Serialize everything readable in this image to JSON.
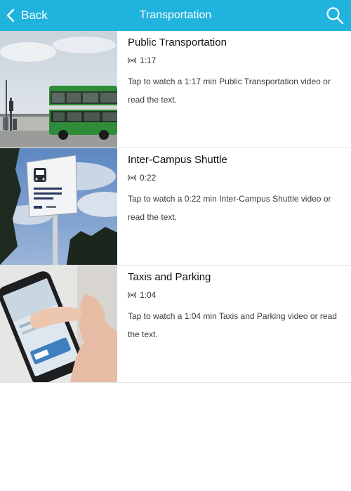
{
  "navbar": {
    "back_label": "Back",
    "title": "Transportation",
    "search_icon": "search-icon",
    "back_icon": "chevron-left-icon",
    "background_color": "#20b3dd"
  },
  "items": [
    {
      "title": "Public Transportation",
      "duration": "1:17",
      "description": "Tap to watch a 1:17 min Public Transportation video or read the text.",
      "thumbnail": "bus-photo"
    },
    {
      "title": "Inter-Campus Shuttle",
      "duration": "0:22",
      "description": "Tap to watch a 0:22 min Inter-Campus Shuttle video or read the text.",
      "thumbnail": "shuttle-bus-sign-photo"
    },
    {
      "title": "Taxis and Parking",
      "duration": "1:04",
      "description": "Tap to watch a 1:04 min Taxis and Parking video or read the text.",
      "thumbnail": "phone-in-hand-photo"
    }
  ]
}
